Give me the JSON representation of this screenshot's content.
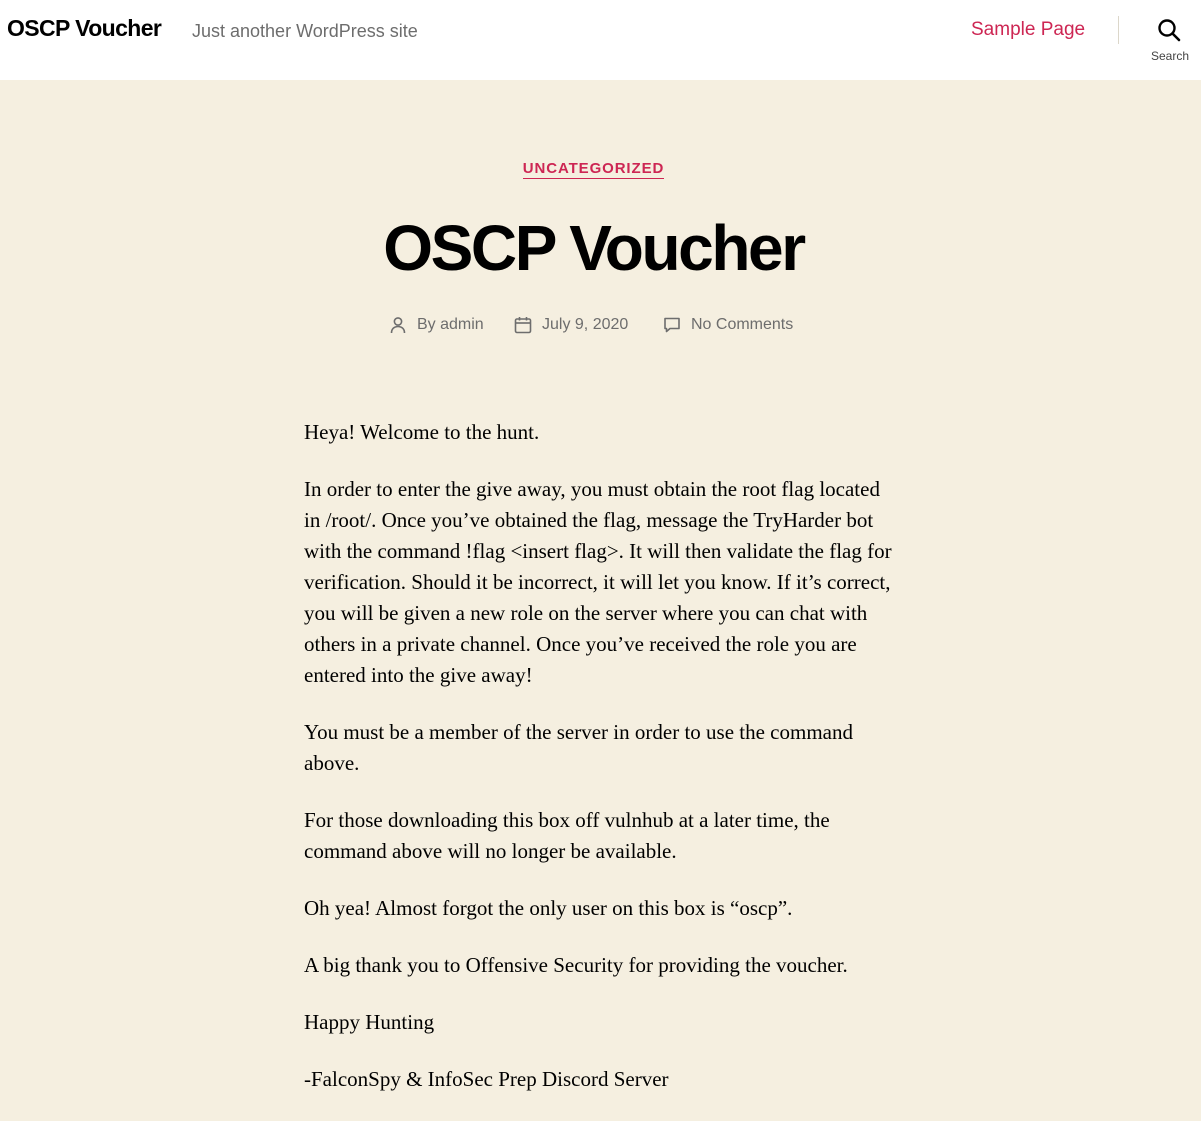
{
  "header": {
    "site_title": "OSCP Voucher",
    "site_description": "Just another WordPress site",
    "nav": [
      {
        "label": "Sample Page"
      }
    ],
    "search_label": "Search"
  },
  "post": {
    "category": "UNCATEGORIZED",
    "title": "OSCP Voucher",
    "meta": {
      "author_prefix": "By",
      "author": "admin",
      "date": "July 9, 2020",
      "comments": "No Comments"
    },
    "paragraphs": [
      "Heya! Welcome to the hunt.",
      "In order to enter the give away, you must obtain the root flag located in /root/. Once you’ve obtained the flag, message the TryHarder bot with the command !flag <insert flag>. It will then validate the flag for verification. Should it be incorrect, it will let you know. If it’s correct, you will be given a new role on the server where you can chat with others in a private channel. Once you’ve received the role you are entered into the give away!",
      "You must be a member of the server in order to use the command above.",
      "For those downloading this box off vulnhub at a later time, the command above will no longer be available.",
      "Oh yea! Almost forgot the only user on this box is “oscp”.",
      "A big thank you to Offensive Security for providing the voucher.",
      "Happy Hunting",
      "-FalconSpy & InfoSec Prep Discord Server"
    ]
  },
  "colors": {
    "accent": "#cd2653",
    "background": "#f5efe0",
    "header_background": "#ffffff",
    "meta_text": "#6d6d6d"
  },
  "icons": {
    "search": "search-icon",
    "author": "user-icon",
    "date": "calendar-icon",
    "comments": "comment-icon"
  }
}
